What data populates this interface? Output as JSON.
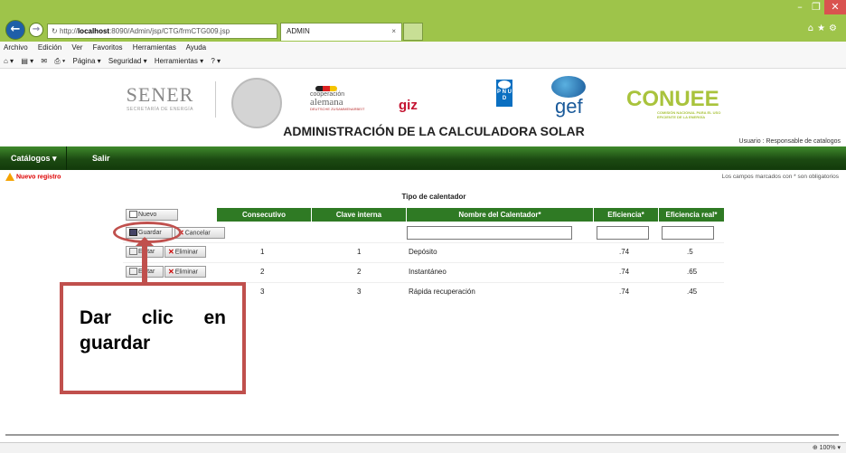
{
  "browser": {
    "url_prefix": "http://",
    "url_host": "localhost",
    "url_rest": ":8090/Admin/jsp/CTG/frmCTG009.jsp",
    "tab_title": "ADMIN",
    "menu": [
      "Archivo",
      "Edición",
      "Ver",
      "Favoritos",
      "Herramientas",
      "Ayuda"
    ],
    "commands": [
      "Página ▾",
      "Seguridad ▾",
      "Herramientas ▾"
    ],
    "zoom": "100%"
  },
  "header": {
    "sener": "SENER",
    "sener_sub": "SECRETARÍA DE ENERGÍA",
    "coop_line1": "cooperación",
    "coop_line2": "alemana",
    "coop_line3": "DEUTSCHE ZUSAMMENARBEIT",
    "giz": "giz",
    "undp": "P N U D",
    "gef": "gef",
    "conuee": "CONUEE",
    "conuee_sub": "COMISIÓN NACIONAL PARA EL USO EFICIENTE DE LA ENERGÍA",
    "title": "ADMINISTRACIÓN DE LA CALCULADORA SOLAR",
    "user": "Usuario : Responsable de catalogos"
  },
  "app_menu": {
    "catalogos": "Catálogos ▾",
    "salir": "Salir"
  },
  "notices": {
    "new_record": "Nuevo registro",
    "required": "Los campos marcados con * son obligatorios"
  },
  "table": {
    "title": "Tipo de calentador",
    "new_button": "Nuevo",
    "headers": [
      "Consecutivo",
      "Clave interna",
      "Nombre del Calentador*",
      "Eficiencia*",
      "Eficiencia real*"
    ],
    "save_button": "Guardar",
    "cancel_button": "Cancelar",
    "edit_button": "Editar",
    "delete_button": "Eliminar",
    "rows": [
      {
        "consecutivo": "1",
        "clave": "1",
        "nombre": "Depósito",
        "eficiencia": ".74",
        "real": ".5"
      },
      {
        "consecutivo": "2",
        "clave": "2",
        "nombre": "Instantáneo",
        "eficiencia": ".74",
        "real": ".65"
      },
      {
        "consecutivo": "3",
        "clave": "3",
        "nombre": "Rápida recuperación",
        "eficiencia": ".74",
        "real": ".45"
      }
    ]
  },
  "annotation": {
    "text": "Dar clic en guardar",
    "color": "#c0504d"
  },
  "colors": {
    "chrome": "#9ec44a",
    "menu_green": "#1c4a12",
    "header_green": "#2f7a24"
  }
}
